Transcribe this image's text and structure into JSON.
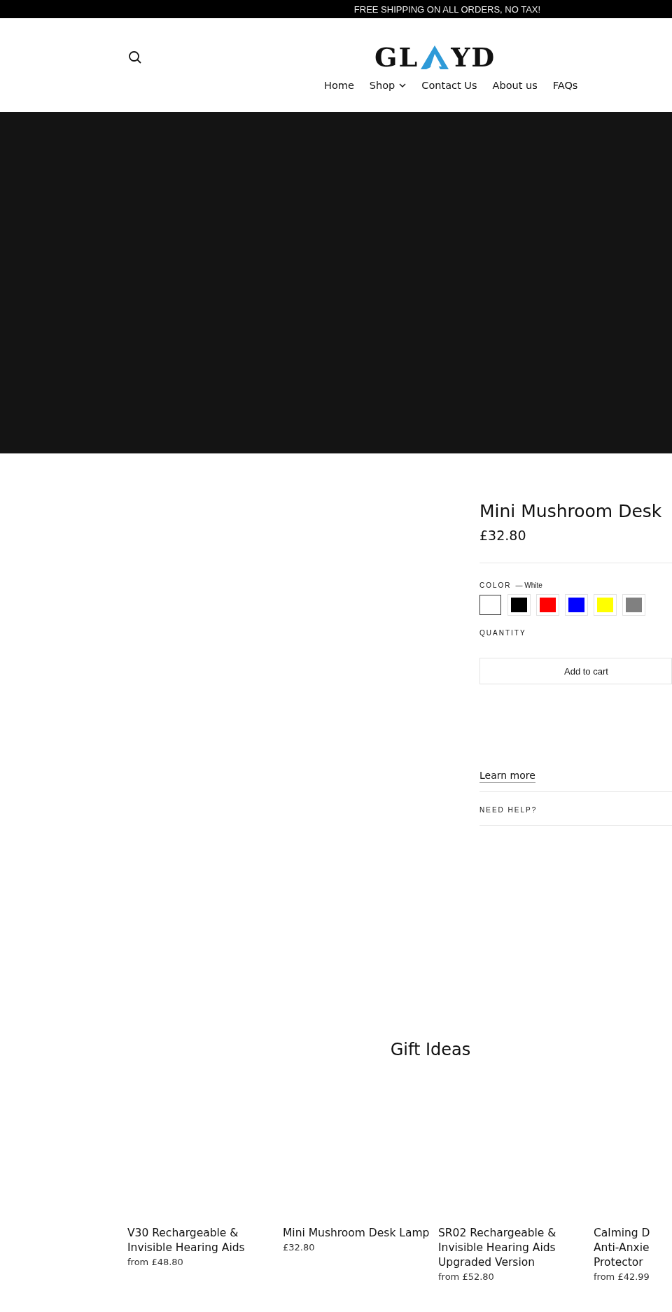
{
  "announcement": "FREE SHIPPING ON ALL ORDERS, NO TAX!",
  "logo": {
    "left": "GL",
    "right": "YD"
  },
  "nav": [
    {
      "label": "Home",
      "dropdown": false
    },
    {
      "label": "Shop",
      "dropdown": true
    },
    {
      "label": "Contact Us",
      "dropdown": false
    },
    {
      "label": "About us",
      "dropdown": false
    },
    {
      "label": "FAQs",
      "dropdown": false
    }
  ],
  "product": {
    "title": "Mini Mushroom Desk",
    "price": "£32.80",
    "color_label": "COLOR",
    "color_value": "— White",
    "swatches": [
      {
        "color": "#ffffff",
        "selected": true
      },
      {
        "color": "#000000",
        "selected": false
      },
      {
        "color": "#ff0000",
        "selected": false
      },
      {
        "color": "#0000ff",
        "selected": false
      },
      {
        "color": "#ffff00",
        "selected": false
      },
      {
        "color": "#808080",
        "selected": false
      }
    ],
    "quantity_label": "QUANTITY",
    "add_to_cart": "Add to cart",
    "learn_more": "Learn more",
    "need_help": "NEED HELP?"
  },
  "gift_ideas": {
    "heading": "Gift Ideas",
    "products": [
      {
        "title": "V30 Rechargeable & Invisible Hearing Aids",
        "price": "from £48.80"
      },
      {
        "title": "Mini Mushroom Desk Lamp",
        "price": "£32.80"
      },
      {
        "title": "SR02 Rechargeable & Invisible Hearing Aids Upgraded Version",
        "price": "from £52.80"
      },
      {
        "title": "Calming D\nAnti-Anxie\nProtector",
        "price": "from £42.99"
      }
    ]
  }
}
